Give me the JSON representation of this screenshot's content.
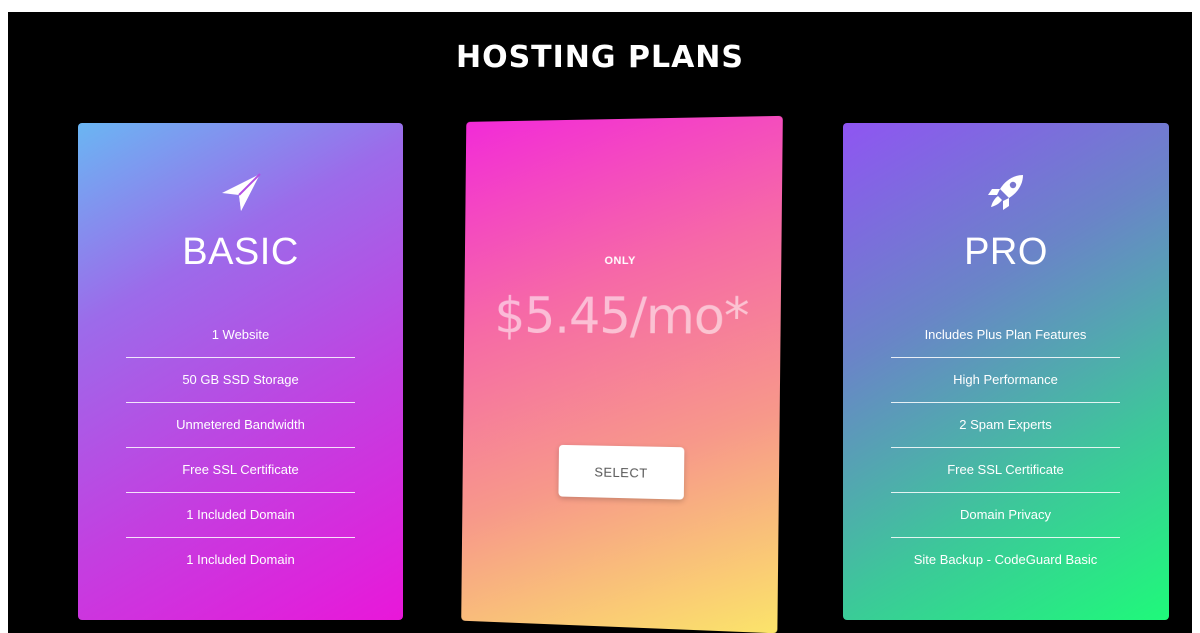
{
  "header": {
    "title": "HOSTING PLANS"
  },
  "plans": {
    "basic": {
      "icon": "paper-plane-icon",
      "name": "BASIC",
      "features": [
        "1 Website",
        "50 GB SSD Storage",
        "Unmetered Bandwidth",
        "Free SSL Certificate",
        "1 Included Domain",
        "1 Included Domain"
      ]
    },
    "featured": {
      "only_label": "ONLY",
      "price": "$5.45/mo*",
      "button_label": "SELECT"
    },
    "pro": {
      "icon": "rocket-icon",
      "name": "PRO",
      "features": [
        "Includes Plus Plan Features",
        "High Performance",
        "2 Spam Experts",
        "Free SSL Certificate",
        "Domain Privacy",
        "Site Backup - CodeGuard Basic"
      ]
    }
  },
  "colors": {
    "background": "#000000",
    "basic_gradient": [
      "#6ab6f3",
      "#c43ee0",
      "#e917d9"
    ],
    "featured_gradient": [
      "#f22bd8",
      "#f7988a",
      "#fbe46a"
    ],
    "pro_gradient": [
      "#8f55f2",
      "#3dc79a",
      "#1ff97a"
    ]
  }
}
